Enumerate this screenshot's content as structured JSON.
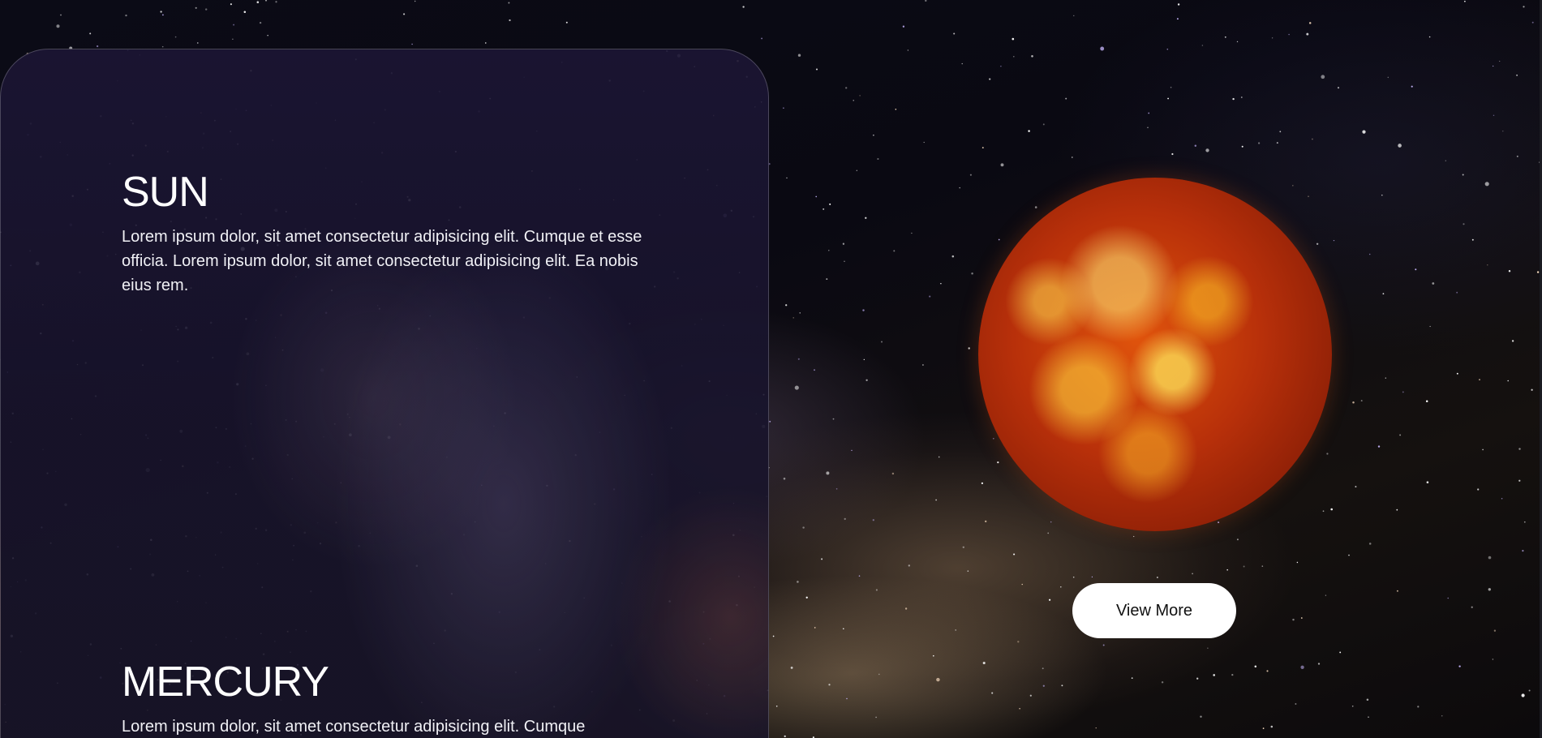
{
  "planets": [
    {
      "name": "SUN",
      "description": "Lorem ipsum dolor, sit amet consectetur adipisicing elit. Cumque et esse officia. Lorem ipsum dolor, sit amet consectetur adipisicing elit. Ea nobis eius rem."
    },
    {
      "name": "MERCURY",
      "description": "Lorem ipsum dolor, sit amet consectetur adipisicing elit. Cumque"
    }
  ],
  "featured": {
    "image_name": "sun-image",
    "button_label": "View More"
  },
  "colors": {
    "background": "#06060c",
    "panel": "#1c1634",
    "text": "#ffffff",
    "button_bg": "#ffffff",
    "button_text": "#111111"
  }
}
